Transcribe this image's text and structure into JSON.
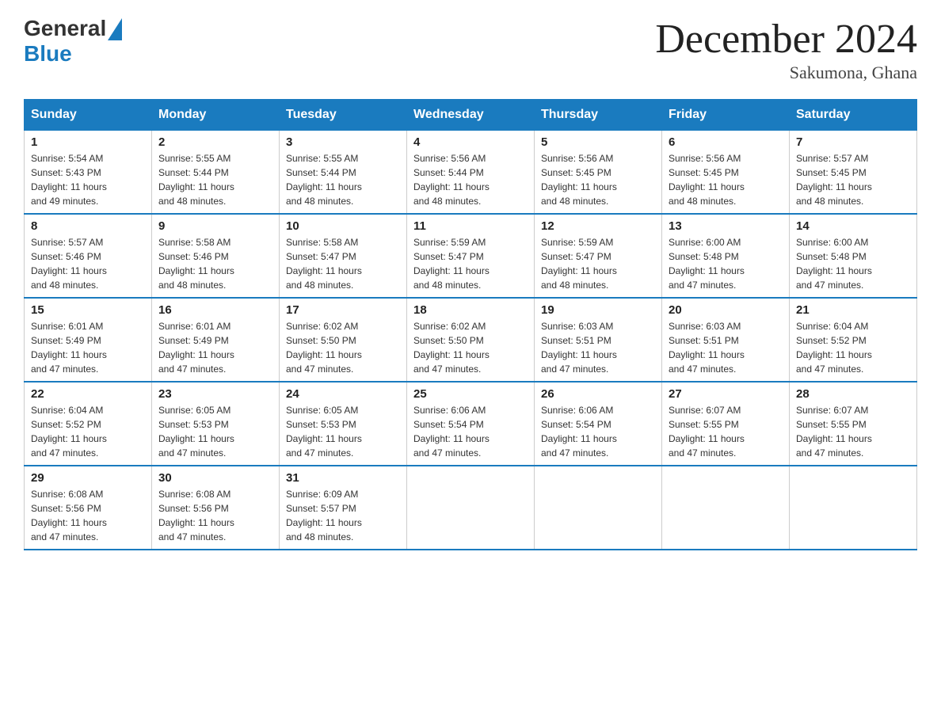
{
  "header": {
    "logo_general": "General",
    "logo_blue": "Blue",
    "title": "December 2024",
    "location": "Sakumona, Ghana"
  },
  "days_of_week": [
    "Sunday",
    "Monday",
    "Tuesday",
    "Wednesday",
    "Thursday",
    "Friday",
    "Saturday"
  ],
  "weeks": [
    [
      {
        "day": "1",
        "sunrise": "5:54 AM",
        "sunset": "5:43 PM",
        "daylight": "11 hours and 49 minutes."
      },
      {
        "day": "2",
        "sunrise": "5:55 AM",
        "sunset": "5:44 PM",
        "daylight": "11 hours and 48 minutes."
      },
      {
        "day": "3",
        "sunrise": "5:55 AM",
        "sunset": "5:44 PM",
        "daylight": "11 hours and 48 minutes."
      },
      {
        "day": "4",
        "sunrise": "5:56 AM",
        "sunset": "5:44 PM",
        "daylight": "11 hours and 48 minutes."
      },
      {
        "day": "5",
        "sunrise": "5:56 AM",
        "sunset": "5:45 PM",
        "daylight": "11 hours and 48 minutes."
      },
      {
        "day": "6",
        "sunrise": "5:56 AM",
        "sunset": "5:45 PM",
        "daylight": "11 hours and 48 minutes."
      },
      {
        "day": "7",
        "sunrise": "5:57 AM",
        "sunset": "5:45 PM",
        "daylight": "11 hours and 48 minutes."
      }
    ],
    [
      {
        "day": "8",
        "sunrise": "5:57 AM",
        "sunset": "5:46 PM",
        "daylight": "11 hours and 48 minutes."
      },
      {
        "day": "9",
        "sunrise": "5:58 AM",
        "sunset": "5:46 PM",
        "daylight": "11 hours and 48 minutes."
      },
      {
        "day": "10",
        "sunrise": "5:58 AM",
        "sunset": "5:47 PM",
        "daylight": "11 hours and 48 minutes."
      },
      {
        "day": "11",
        "sunrise": "5:59 AM",
        "sunset": "5:47 PM",
        "daylight": "11 hours and 48 minutes."
      },
      {
        "day": "12",
        "sunrise": "5:59 AM",
        "sunset": "5:47 PM",
        "daylight": "11 hours and 48 minutes."
      },
      {
        "day": "13",
        "sunrise": "6:00 AM",
        "sunset": "5:48 PM",
        "daylight": "11 hours and 47 minutes."
      },
      {
        "day": "14",
        "sunrise": "6:00 AM",
        "sunset": "5:48 PM",
        "daylight": "11 hours and 47 minutes."
      }
    ],
    [
      {
        "day": "15",
        "sunrise": "6:01 AM",
        "sunset": "5:49 PM",
        "daylight": "11 hours and 47 minutes."
      },
      {
        "day": "16",
        "sunrise": "6:01 AM",
        "sunset": "5:49 PM",
        "daylight": "11 hours and 47 minutes."
      },
      {
        "day": "17",
        "sunrise": "6:02 AM",
        "sunset": "5:50 PM",
        "daylight": "11 hours and 47 minutes."
      },
      {
        "day": "18",
        "sunrise": "6:02 AM",
        "sunset": "5:50 PM",
        "daylight": "11 hours and 47 minutes."
      },
      {
        "day": "19",
        "sunrise": "6:03 AM",
        "sunset": "5:51 PM",
        "daylight": "11 hours and 47 minutes."
      },
      {
        "day": "20",
        "sunrise": "6:03 AM",
        "sunset": "5:51 PM",
        "daylight": "11 hours and 47 minutes."
      },
      {
        "day": "21",
        "sunrise": "6:04 AM",
        "sunset": "5:52 PM",
        "daylight": "11 hours and 47 minutes."
      }
    ],
    [
      {
        "day": "22",
        "sunrise": "6:04 AM",
        "sunset": "5:52 PM",
        "daylight": "11 hours and 47 minutes."
      },
      {
        "day": "23",
        "sunrise": "6:05 AM",
        "sunset": "5:53 PM",
        "daylight": "11 hours and 47 minutes."
      },
      {
        "day": "24",
        "sunrise": "6:05 AM",
        "sunset": "5:53 PM",
        "daylight": "11 hours and 47 minutes."
      },
      {
        "day": "25",
        "sunrise": "6:06 AM",
        "sunset": "5:54 PM",
        "daylight": "11 hours and 47 minutes."
      },
      {
        "day": "26",
        "sunrise": "6:06 AM",
        "sunset": "5:54 PM",
        "daylight": "11 hours and 47 minutes."
      },
      {
        "day": "27",
        "sunrise": "6:07 AM",
        "sunset": "5:55 PM",
        "daylight": "11 hours and 47 minutes."
      },
      {
        "day": "28",
        "sunrise": "6:07 AM",
        "sunset": "5:55 PM",
        "daylight": "11 hours and 47 minutes."
      }
    ],
    [
      {
        "day": "29",
        "sunrise": "6:08 AM",
        "sunset": "5:56 PM",
        "daylight": "11 hours and 47 minutes."
      },
      {
        "day": "30",
        "sunrise": "6:08 AM",
        "sunset": "5:56 PM",
        "daylight": "11 hours and 47 minutes."
      },
      {
        "day": "31",
        "sunrise": "6:09 AM",
        "sunset": "5:57 PM",
        "daylight": "11 hours and 48 minutes."
      },
      null,
      null,
      null,
      null
    ]
  ],
  "labels": {
    "sunrise": "Sunrise:",
    "sunset": "Sunset:",
    "daylight": "Daylight:"
  }
}
